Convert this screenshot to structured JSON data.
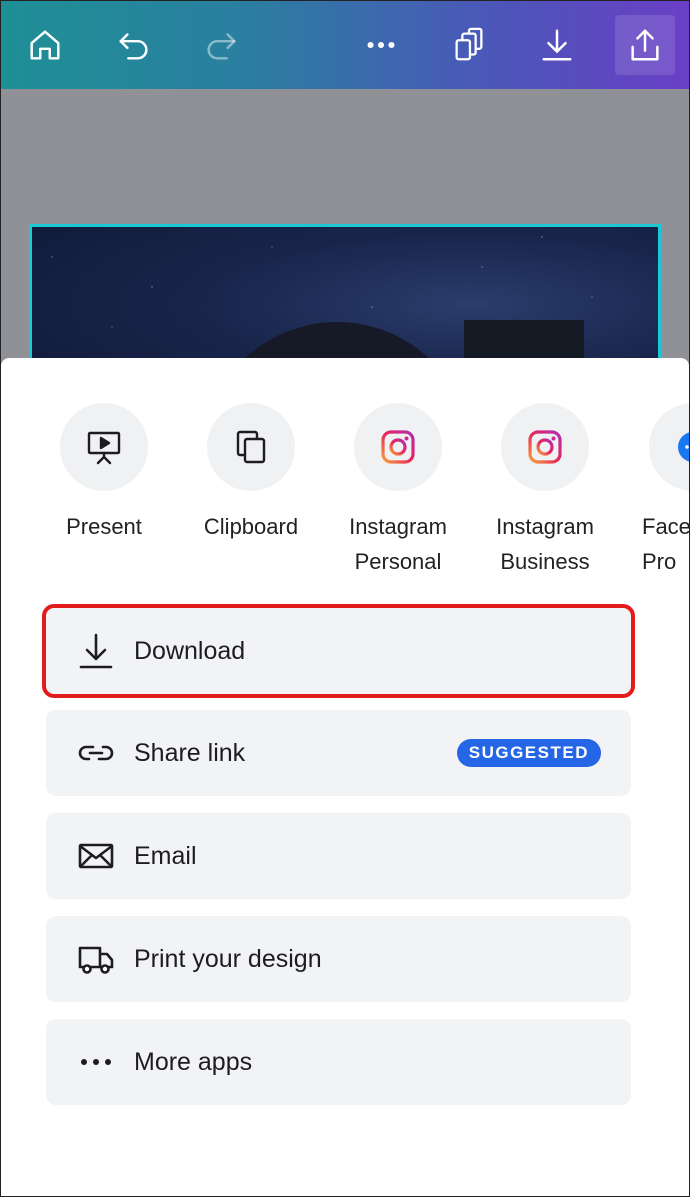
{
  "toolbar": {
    "buttons": [
      "home-icon",
      "undo-icon",
      "redo-icon",
      "more-icon",
      "pages-icon",
      "download-icon",
      "share-icon"
    ]
  },
  "share_targets": [
    {
      "label": "Present",
      "icon": "present-icon"
    },
    {
      "label": "Clipboard",
      "icon": "clipboard-icon"
    },
    {
      "label": "Instagram\nPersonal",
      "icon": "instagram-icon"
    },
    {
      "label": "Instagram\nBusiness",
      "icon": "instagram-icon"
    },
    {
      "label": "Face\nPro",
      "icon": "facebook-icon"
    }
  ],
  "options": {
    "download": "Download",
    "share_link": "Share link",
    "share_link_badge": "SUGGESTED",
    "email": "Email",
    "print": "Print your design",
    "more_apps": "More apps"
  },
  "colors": {
    "highlight": "#e21b1b",
    "badge": "#2466e6"
  }
}
